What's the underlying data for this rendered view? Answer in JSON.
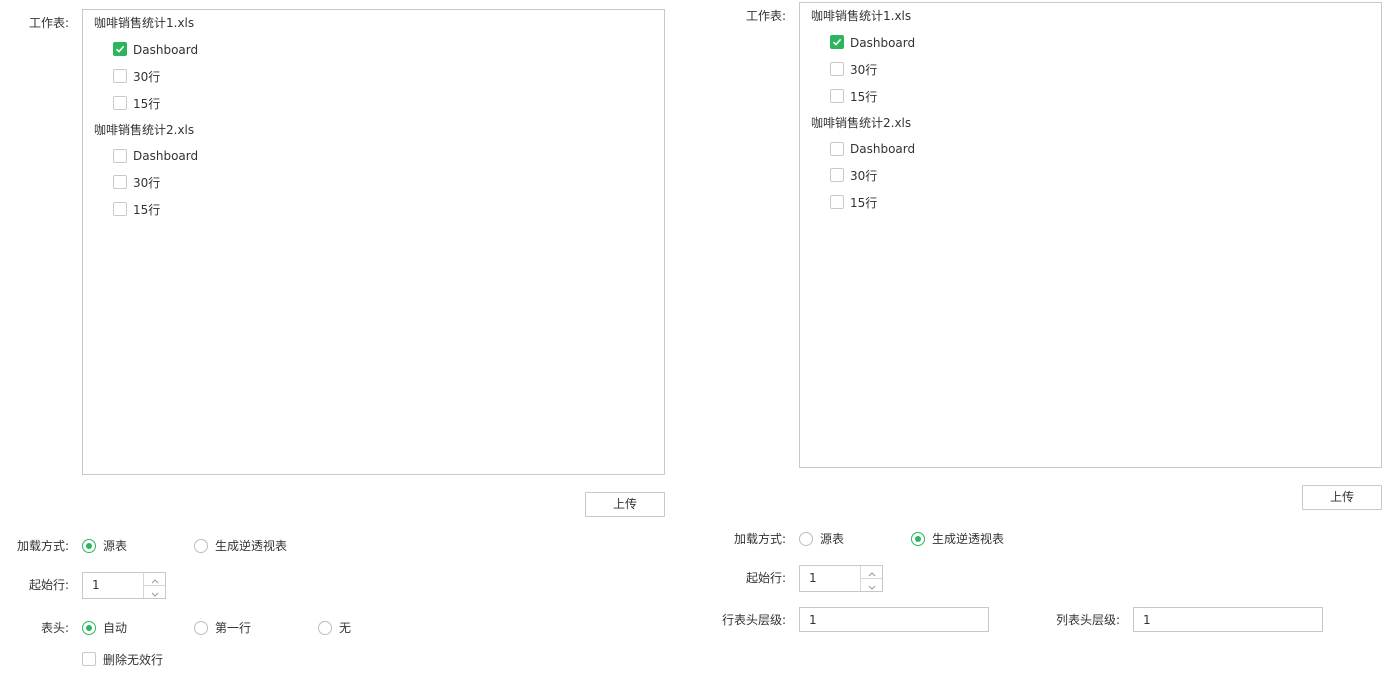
{
  "left": {
    "worksheet_label": "工作表:",
    "files": [
      {
        "name": "咖啡销售统计1.xls",
        "sheets": [
          {
            "label": "Dashboard",
            "checked": true
          },
          {
            "label": "30行",
            "checked": false
          },
          {
            "label": "15行",
            "checked": false
          }
        ]
      },
      {
        "name": "咖啡销售统计2.xls",
        "sheets": [
          {
            "label": "Dashboard",
            "checked": false
          },
          {
            "label": "30行",
            "checked": false
          },
          {
            "label": "15行",
            "checked": false
          }
        ]
      }
    ],
    "upload_label": "上传",
    "load_mode_label": "加载方式:",
    "load_mode_options": [
      {
        "label": "源表",
        "selected": true
      },
      {
        "label": "生成逆透视表",
        "selected": false
      }
    ],
    "start_row_label": "起始行:",
    "start_row_value": "1",
    "header_label": "表头:",
    "header_options": [
      {
        "label": "自动",
        "selected": true
      },
      {
        "label": "第一行",
        "selected": false
      },
      {
        "label": "无",
        "selected": false
      }
    ],
    "delete_invalid_label": "删除无效行",
    "delete_invalid_checked": false
  },
  "right": {
    "worksheet_label": "工作表:",
    "files": [
      {
        "name": "咖啡销售统计1.xls",
        "sheets": [
          {
            "label": "Dashboard",
            "checked": true
          },
          {
            "label": "30行",
            "checked": false
          },
          {
            "label": "15行",
            "checked": false
          }
        ]
      },
      {
        "name": "咖啡销售统计2.xls",
        "sheets": [
          {
            "label": "Dashboard",
            "checked": false
          },
          {
            "label": "30行",
            "checked": false
          },
          {
            "label": "15行",
            "checked": false
          }
        ]
      }
    ],
    "upload_label": "上传",
    "load_mode_label": "加载方式:",
    "load_mode_options": [
      {
        "label": "源表",
        "selected": false
      },
      {
        "label": "生成逆透视表",
        "selected": true
      }
    ],
    "start_row_label": "起始行:",
    "start_row_value": "1",
    "row_header_level_label": "行表头层级:",
    "row_header_level_value": "1",
    "col_header_level_label": "列表头层级:",
    "col_header_level_value": "1"
  },
  "colors": {
    "accent": "#2db55d",
    "border": "#c8c8c8",
    "text": "#333333"
  }
}
